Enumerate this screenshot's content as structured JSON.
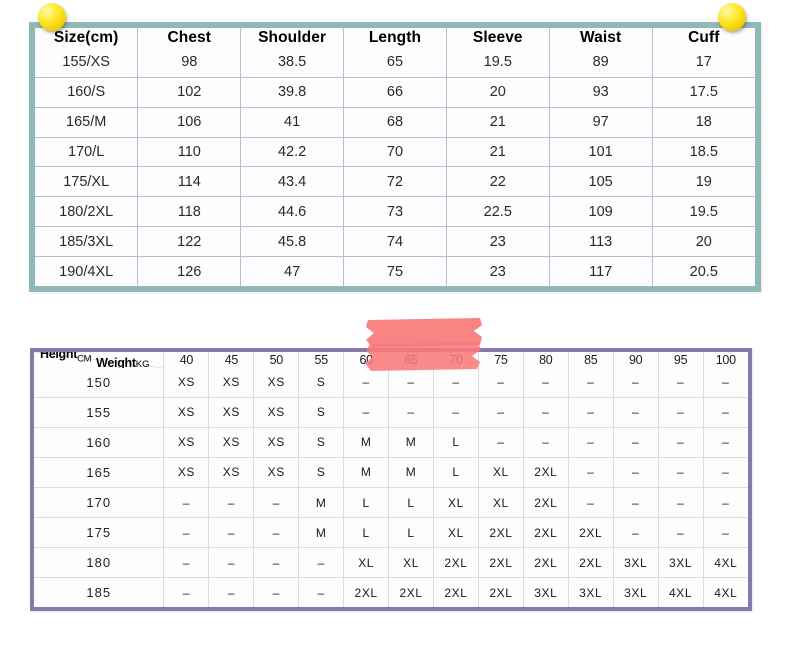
{
  "size_chart": {
    "columns": [
      "Size(cm)",
      "Chest",
      "Shoulder",
      "Length",
      "Sleeve",
      "Waist",
      "Cuff"
    ],
    "rows": [
      [
        "155/XS",
        "98",
        "38.5",
        "65",
        "19.5",
        "89",
        "17"
      ],
      [
        "160/S",
        "102",
        "39.8",
        "66",
        "20",
        "93",
        "17.5"
      ],
      [
        "165/M",
        "106",
        "41",
        "68",
        "21",
        "97",
        "18"
      ],
      [
        "170/L",
        "110",
        "42.2",
        "70",
        "21",
        "101",
        "18.5"
      ],
      [
        "175/XL",
        "114",
        "43.4",
        "72",
        "22",
        "105",
        "19"
      ],
      [
        "180/2XL",
        "118",
        "44.6",
        "73",
        "22.5",
        "109",
        "19.5"
      ],
      [
        "185/3XL",
        "122",
        "45.8",
        "74",
        "23",
        "113",
        "20"
      ],
      [
        "190/4XL",
        "126",
        "47",
        "75",
        "23",
        "117",
        "20.5"
      ]
    ],
    "border_color": "#8fb9b9",
    "grid_color": "#b9bcd6"
  },
  "fit_matrix": {
    "corner": {
      "weight_label": "Weight",
      "weight_unit": "KG",
      "height_label": "Height",
      "height_unit": "CM"
    },
    "weights": [
      "40",
      "45",
      "50",
      "55",
      "60",
      "65",
      "70",
      "75",
      "80",
      "85",
      "90",
      "95",
      "100"
    ],
    "heights": [
      "150",
      "155",
      "160",
      "165",
      "170",
      "175",
      "180",
      "185"
    ],
    "rows": [
      [
        "XS",
        "XS",
        "XS",
        "S",
        "–",
        "–",
        "–",
        "–",
        "–",
        "–",
        "–",
        "–",
        "–"
      ],
      [
        "XS",
        "XS",
        "XS",
        "S",
        "–",
        "–",
        "–",
        "–",
        "–",
        "–",
        "–",
        "–",
        "–"
      ],
      [
        "XS",
        "XS",
        "XS",
        "S",
        "M",
        "M",
        "L",
        "–",
        "–",
        "–",
        "–",
        "–",
        "–"
      ],
      [
        "XS",
        "XS",
        "XS",
        "S",
        "M",
        "M",
        "L",
        "XL",
        "2XL",
        "–",
        "–",
        "–",
        "–"
      ],
      [
        "–",
        "–",
        "–",
        "M",
        "L",
        "L",
        "XL",
        "XL",
        "2XL",
        "–",
        "–",
        "–",
        "–"
      ],
      [
        "–",
        "–",
        "–",
        "M",
        "L",
        "L",
        "XL",
        "2XL",
        "2XL",
        "2XL",
        "–",
        "–",
        "–"
      ],
      [
        "–",
        "–",
        "–",
        "–",
        "XL",
        "XL",
        "2XL",
        "2XL",
        "2XL",
        "2XL",
        "3XL",
        "3XL",
        "4XL"
      ],
      [
        "–",
        "–",
        "–",
        "–",
        "2XL",
        "2XL",
        "2XL",
        "2XL",
        "3XL",
        "3XL",
        "3XL",
        "4XL",
        "4XL"
      ]
    ],
    "border_color": "#8878ae",
    "grid_color": "#dcdcdc"
  },
  "annotations": {
    "pins": [
      {
        "name": "top-left-pin",
        "color": "#ffe92e"
      },
      {
        "name": "top-right-pin",
        "color": "#ffe92e"
      }
    ],
    "highlighter": {
      "color": "#f97a7a",
      "strokes": 2,
      "covers_columns": [
        "60",
        "65",
        "70",
        "75"
      ]
    }
  }
}
